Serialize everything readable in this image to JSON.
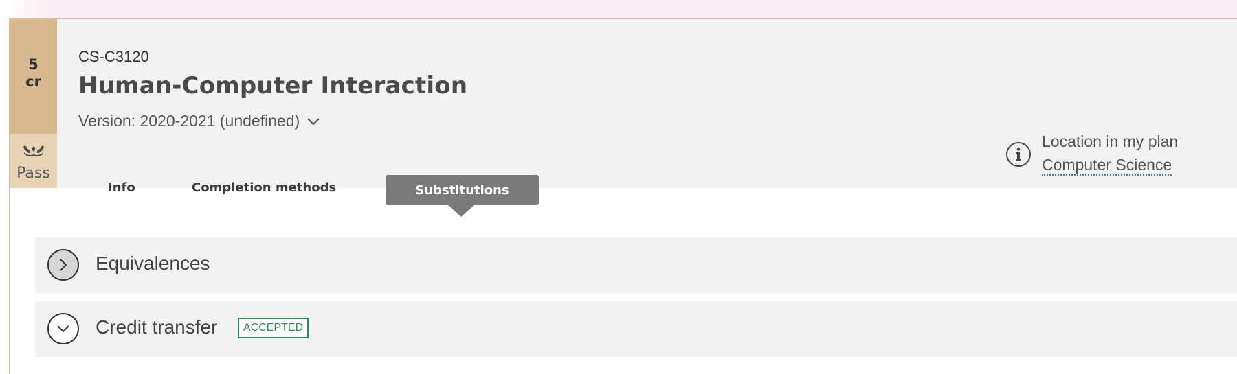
{
  "course": {
    "credits_number": "5",
    "credits_unit": "cr",
    "grade": "Pass",
    "code": "CS-C3120",
    "title": "Human-Computer Interaction",
    "version": "Version: 2020-2021 (undefined)"
  },
  "tabs": [
    {
      "label": "Info",
      "active": false
    },
    {
      "label": "Completion methods",
      "active": false
    },
    {
      "label": "Substitutions",
      "active": true
    }
  ],
  "plan_location": {
    "label": "Location in my plan",
    "link": "Computer Science"
  },
  "sections": [
    {
      "title": "Equivalences",
      "state": "collapsed",
      "icon": "chevron-right-icon"
    },
    {
      "title": "Credit transfer",
      "state": "expanded",
      "icon": "chevron-down-icon",
      "badge": "ACCEPTED"
    }
  ],
  "colors": {
    "credit_box": "#d9b98f",
    "grade_box": "#e8d3b7",
    "header_bg": "#f2f2f2",
    "active_tab": "#7a7a7a",
    "accepted_badge": "#2f8d55",
    "link_underline": "#3a79c9",
    "top_strip": "#faeff4"
  }
}
